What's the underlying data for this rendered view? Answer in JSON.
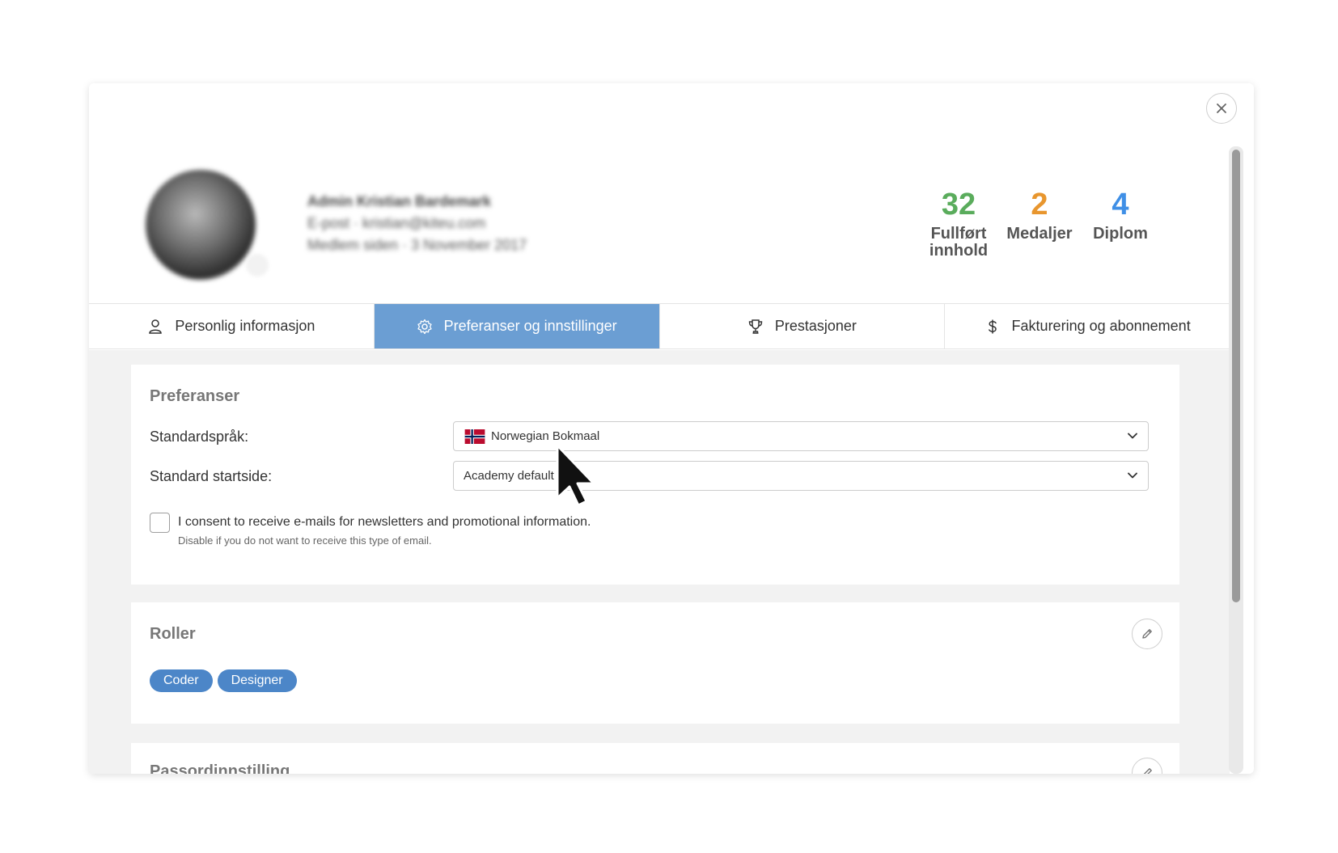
{
  "profile": {
    "name": "Admin Kristian Bardemark",
    "email": "E-post · kristian@kiteu.com",
    "member_since": "Medlem siden · 3 November 2017"
  },
  "stats": [
    {
      "value": "32",
      "label_line1": "Fullført",
      "label_line2": "innhold",
      "color": "#5aac5c"
    },
    {
      "value": "2",
      "label_line1": "Medaljer",
      "label_line2": "",
      "color": "#e8962e"
    },
    {
      "value": "4",
      "label_line1": "Diplom",
      "label_line2": "",
      "color": "#3f8fe6"
    }
  ],
  "tabs": [
    {
      "label": "Personlig informasjon",
      "icon": "user-icon",
      "active": false
    },
    {
      "label": "Preferanser og innstillinger",
      "icon": "gear-icon",
      "active": true
    },
    {
      "label": "Prestasjoner",
      "icon": "trophy-icon",
      "active": false
    },
    {
      "label": "Fakturering og abonnement",
      "icon": "dollar-icon",
      "active": false
    }
  ],
  "preferences": {
    "title": "Preferanser",
    "language_label": "Standardspråk:",
    "language_value": "Norwegian Bokmaal",
    "startpage_label": "Standard startside:",
    "startpage_value": "Academy default",
    "consent_text": "I consent to receive e-mails for newsletters and promotional information.",
    "consent_hint": "Disable if you do not want to receive this type of email.",
    "consent_checked": false
  },
  "roles": {
    "title": "Roller",
    "items": [
      "Coder",
      "Designer"
    ]
  },
  "password": {
    "title": "Passordinnstilling"
  },
  "colors": {
    "active_tab": "#6b9ed3",
    "tag": "#4c86c8"
  }
}
